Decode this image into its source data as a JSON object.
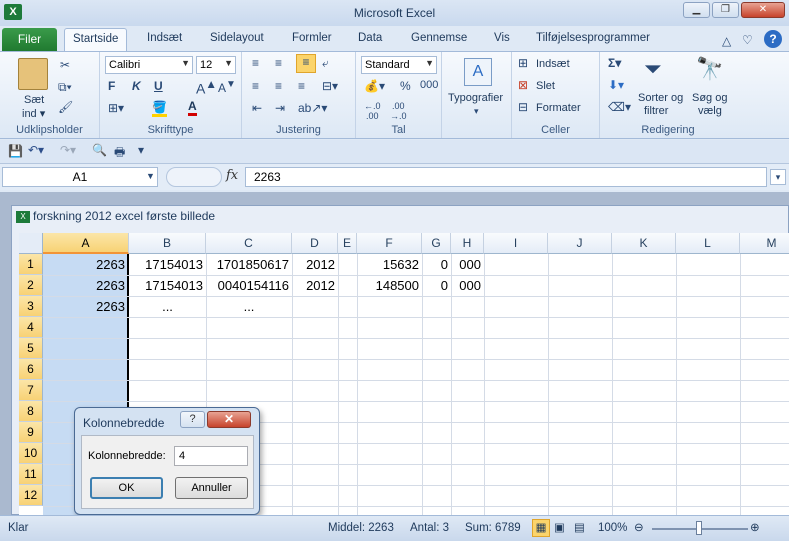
{
  "window": {
    "title": "Microsoft Excel"
  },
  "ribbon": {
    "file_tab": "Filer",
    "tabs": [
      "Startside",
      "Indsæt",
      "Sidelayout",
      "Formler",
      "Data",
      "Gennemse",
      "Vis",
      "Tilføjelsesprogrammer"
    ],
    "active_tab": "Startside",
    "groups": {
      "clipboard": {
        "name": "Udklipsholder",
        "paste": "Sæt",
        "paste2": "ind ▾"
      },
      "font": {
        "name": "Skrifttype",
        "font_name": "Calibri",
        "font_size": "12",
        "bold": "F",
        "italic": "K",
        "underline": "U"
      },
      "alignment": {
        "name": "Justering"
      },
      "number": {
        "name": "Tal",
        "format": "Standard",
        "percent": "%",
        "thousands": "000"
      },
      "styles": {
        "name": "",
        "label": "Typografier"
      },
      "cells": {
        "name": "Celler",
        "insert": "Indsæt",
        "delete": "Slet",
        "format": "Formater"
      },
      "editing": {
        "name": "Redigering",
        "sort": "Sorter og",
        "sort2": "filtrer",
        "find": "Søg og",
        "find2": "vælg"
      }
    }
  },
  "formula_bar": {
    "name_box": "A1",
    "fx": "fx",
    "formula": "2263"
  },
  "workbook": {
    "title": "forskning 2012 excel første billede"
  },
  "grid": {
    "columns": [
      "A",
      "B",
      "C",
      "D",
      "E",
      "F",
      "G",
      "H",
      "I",
      "J",
      "K",
      "L",
      "M"
    ],
    "rows": [
      "1",
      "2",
      "3",
      "4",
      "5",
      "6",
      "7",
      "8",
      "9",
      "10",
      "11",
      "12"
    ],
    "cells": {
      "r1": {
        "A": "2263",
        "B": "17154013",
        "C": "1701850617",
        "D": "2012",
        "F": "15632",
        "G": "0",
        "H": "000"
      },
      "r2": {
        "A": "2263",
        "B": "17154013",
        "C": "0040154116",
        "D": "2012",
        "F": "148500",
        "G": "0",
        "H": "000"
      },
      "r3": {
        "A": "2263",
        "B": "...",
        "C": "..."
      }
    }
  },
  "status_bar": {
    "mode": "Klar",
    "average": "Middel: 2263",
    "count": "Antal: 3",
    "sum": "Sum: 6789",
    "zoom": "100%"
  },
  "dialog": {
    "title": "Kolonnebredde",
    "label": "Kolonnebredde:",
    "value": "4",
    "ok": "OK",
    "cancel": "Annuller",
    "help": "?",
    "close": "✕"
  }
}
